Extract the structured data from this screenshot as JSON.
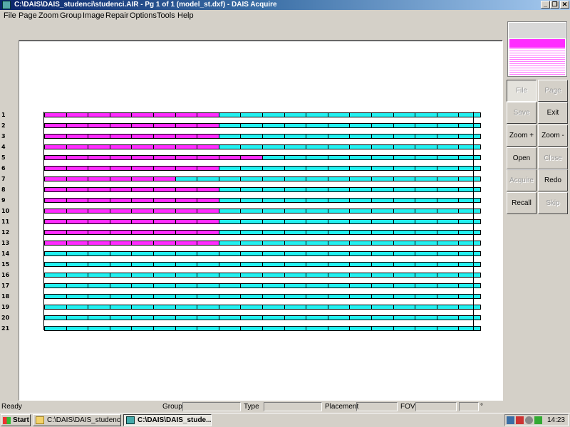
{
  "window": {
    "title": "C:\\DAIS\\DAIS_studenci\\studenci.AIR - Pg 1 of 1 (model_st.dxf) - DAIS Acquire",
    "minimize_glyph": "_",
    "maximize_glyph": "❐",
    "close_glyph": "✕"
  },
  "menu": [
    "File",
    "Page",
    "Zoom",
    "Group",
    "Image",
    "Repair",
    "Options",
    "Tools",
    "Help"
  ],
  "rows": {
    "labels": [
      "1",
      "2",
      "3",
      "4",
      "5",
      "6",
      "7",
      "8",
      "9",
      "10",
      "11",
      "12",
      "13",
      "14",
      "15",
      "16",
      "17",
      "18",
      "19",
      "20",
      "21"
    ],
    "magenta_cells": [
      8,
      8,
      8,
      8,
      10,
      8,
      6,
      8,
      8,
      8,
      8,
      8,
      8,
      0,
      0,
      0,
      0,
      0,
      0,
      0,
      0
    ],
    "cells_per_row": 20
  },
  "colors": {
    "filled": "#ff2cff",
    "empty": "#22f0f0"
  },
  "buttons": {
    "file": "File",
    "page": "Page",
    "save": "Save",
    "exit": "Exit",
    "zoom_in": "Zoom +",
    "zoom_out": "Zoom -",
    "open": "Open",
    "close": "Close",
    "acquire": "Acquire",
    "redo": "Redo",
    "recall": "Recall",
    "skip": "Skip"
  },
  "status": {
    "state": "Ready",
    "group_label": "Group",
    "type_label": "Type",
    "placement_label": "Placement",
    "fov_label": "FOV",
    "degree": "°"
  },
  "taskbar": {
    "start": "Start",
    "task1": "C:\\DAIS\\DAIS_studenci",
    "task2": "C:\\DAIS\\DAIS_stude...",
    "clock": "14:23"
  }
}
